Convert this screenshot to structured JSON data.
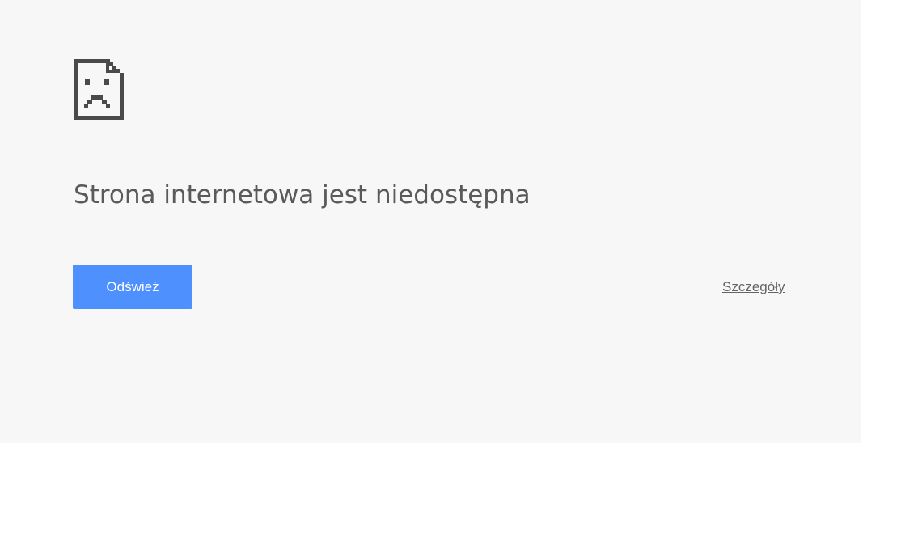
{
  "error_page": {
    "icon": "sad-page-icon",
    "heading": "Strona internetowa jest niedostępna",
    "reload_button_label": "Odśwież",
    "details_link_label": "Szczegóły"
  },
  "colors": {
    "page_background": "#f7f7f7",
    "outer_background": "#ffffff",
    "icon": "#4a4a4a",
    "heading_text": "#5a5a5a",
    "button_background": "#4d90fe",
    "button_text": "#ffffff",
    "link_text": "#646464"
  }
}
